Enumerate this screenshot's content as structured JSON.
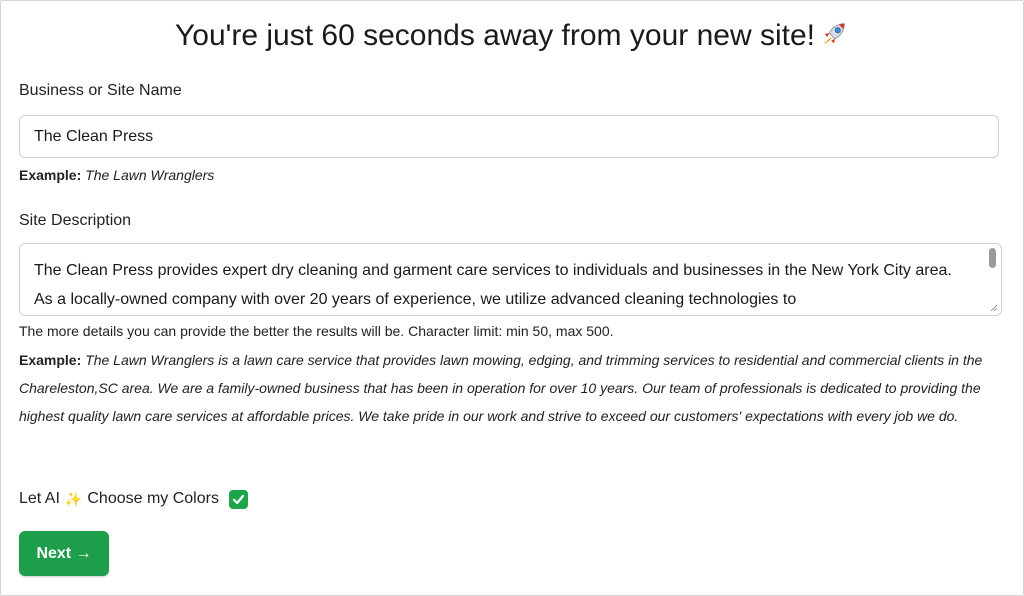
{
  "header": {
    "title": "You're just 60 seconds away from your new site!",
    "title_icon": "rocket-icon"
  },
  "business_name": {
    "label": "Business or Site Name",
    "value": "The Clean Press",
    "example_prefix": "Example:",
    "example_text": "The Lawn Wranglers"
  },
  "site_description": {
    "label": "Site Description",
    "value": "The Clean Press provides expert dry cleaning and garment care services to individuals and businesses in the New York City area. As a locally-owned company with over 20 years of experience, we utilize advanced cleaning technologies to",
    "char_limit_text": "The more details you can provide the better the results will be. Character limit: min 50, max 500.",
    "example_prefix": "Example:",
    "example_text": "The Lawn Wranglers is a lawn care service that provides lawn mowing, edging, and trimming services to residential and commercial clients in the Chareleston,SC area. We are a family-owned business that has been in operation for over 10 years. Our team of professionals is dedicated to providing the highest quality lawn care services at affordable prices. We take pride in our work and strive to exceed our customers' expectations with every job we do."
  },
  "ai_colors": {
    "label_before": "Let AI",
    "sparkle_icon": "sparkle-icon",
    "label_after": "Choose my Colors",
    "checked": true,
    "accent_color": "#1ea54c"
  },
  "actions": {
    "next_label": "Next →",
    "button_color": "#1e9e4a"
  }
}
